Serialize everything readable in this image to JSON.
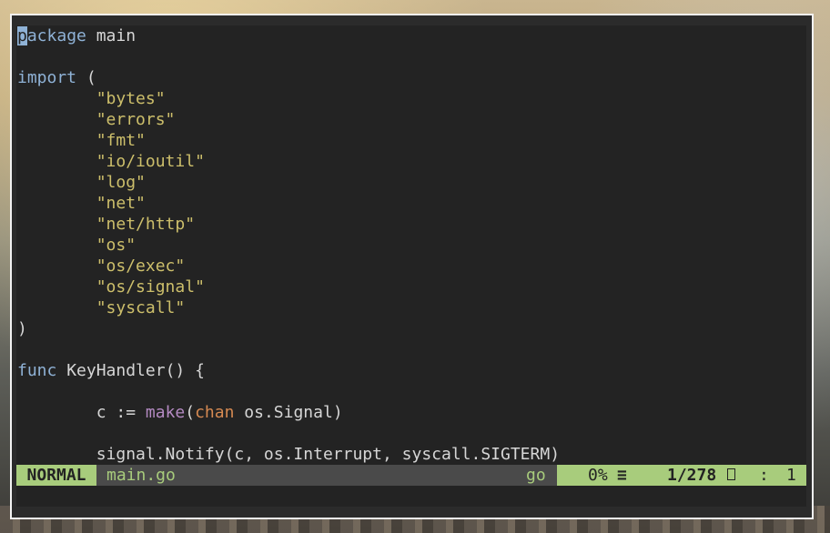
{
  "editor": {
    "lines": [
      [
        {
          "t": "p",
          "c": "cursor"
        },
        {
          "t": "ackage",
          "c": "kw"
        },
        {
          "t": " main",
          "c": ""
        }
      ],
      [],
      [
        {
          "t": "import",
          "c": "kw"
        },
        {
          "t": " (",
          "c": ""
        }
      ],
      [
        {
          "t": "        ",
          "c": ""
        },
        {
          "t": "\"bytes\"",
          "c": "str"
        }
      ],
      [
        {
          "t": "        ",
          "c": ""
        },
        {
          "t": "\"errors\"",
          "c": "str"
        }
      ],
      [
        {
          "t": "        ",
          "c": ""
        },
        {
          "t": "\"fmt\"",
          "c": "str"
        }
      ],
      [
        {
          "t": "        ",
          "c": ""
        },
        {
          "t": "\"io/ioutil\"",
          "c": "str"
        }
      ],
      [
        {
          "t": "        ",
          "c": ""
        },
        {
          "t": "\"log\"",
          "c": "str"
        }
      ],
      [
        {
          "t": "        ",
          "c": ""
        },
        {
          "t": "\"net\"",
          "c": "str"
        }
      ],
      [
        {
          "t": "        ",
          "c": ""
        },
        {
          "t": "\"net/http\"",
          "c": "str"
        }
      ],
      [
        {
          "t": "        ",
          "c": ""
        },
        {
          "t": "\"os\"",
          "c": "str"
        }
      ],
      [
        {
          "t": "        ",
          "c": ""
        },
        {
          "t": "\"os/exec\"",
          "c": "str"
        }
      ],
      [
        {
          "t": "        ",
          "c": ""
        },
        {
          "t": "\"os/signal\"",
          "c": "str"
        }
      ],
      [
        {
          "t": "        ",
          "c": ""
        },
        {
          "t": "\"syscall\"",
          "c": "str"
        }
      ],
      [
        {
          "t": ")",
          "c": ""
        }
      ],
      [],
      [
        {
          "t": "func",
          "c": "kw"
        },
        {
          "t": " KeyHandler() {",
          "c": ""
        }
      ],
      [],
      [
        {
          "t": "        c := ",
          "c": ""
        },
        {
          "t": "make",
          "c": "fn"
        },
        {
          "t": "(",
          "c": ""
        },
        {
          "t": "chan",
          "c": "typ"
        },
        {
          "t": " os.Signal)",
          "c": ""
        }
      ],
      [],
      [
        {
          "t": "        signal.Notify(c, os.Interrupt, syscall.SIGTERM)",
          "c": ""
        }
      ]
    ]
  },
  "statusline": {
    "mode": "NORMAL",
    "filename": "main.go",
    "filetype": "go",
    "percent": "0%",
    "menu_icon": "≡",
    "line_info": "1/278",
    "line_icon": "line-number-icon",
    "col_sep": ":",
    "column": "1"
  },
  "colors": {
    "background": "#232323",
    "keyword": "#8fb2d6",
    "string": "#cdbf6b",
    "builtin_function": "#b48ac2",
    "type": "#d68a52",
    "mode_accent": "#a8cc7c"
  }
}
